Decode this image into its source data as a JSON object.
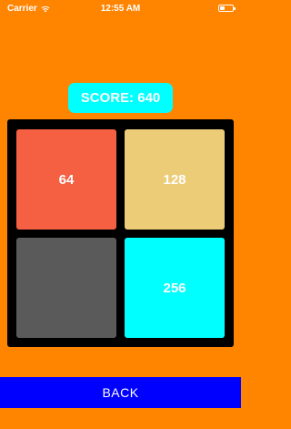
{
  "status_bar": {
    "carrier": "Carrier",
    "time": "12:55 AM",
    "wifi_icon": "wifi-icon",
    "battery_icon": "battery-icon"
  },
  "score": {
    "label": "SCORE: 640",
    "color": "#00FFFF"
  },
  "board": {
    "background": "#000000",
    "tiles": [
      {
        "value": "64",
        "color": "#F55F42"
      },
      {
        "value": "128",
        "color": "#EDCC78"
      },
      {
        "value": "",
        "color": "#5A5A5A"
      },
      {
        "value": "256",
        "color": "#00FFFF"
      }
    ]
  },
  "footer": {
    "back_label": "BACK",
    "color": "#0000FF"
  },
  "colors": {
    "background": "#FF8400",
    "text": "#FFFFFF"
  }
}
